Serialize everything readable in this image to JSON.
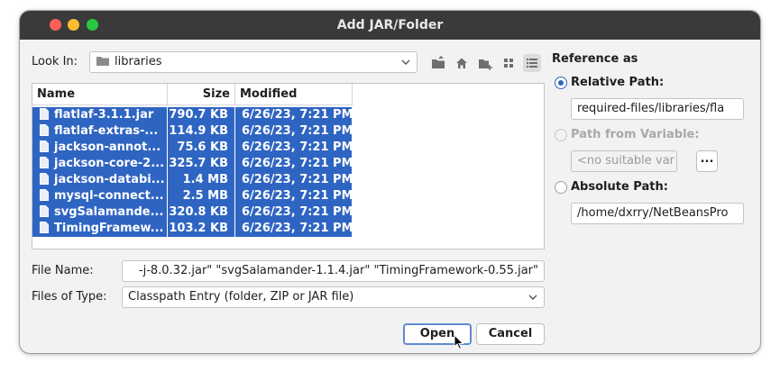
{
  "window": {
    "title": "Add JAR/Folder"
  },
  "look_in": {
    "label": "Look In:",
    "value": "libraries"
  },
  "toolbar": [
    "up-folder-icon",
    "home-icon",
    "new-folder-icon",
    "list-view-icon",
    "details-view-icon"
  ],
  "file_table": {
    "headers": {
      "name": "Name",
      "size": "Size",
      "modified": "Modified"
    },
    "rows": [
      {
        "name": "flatlaf-3.1.1.jar",
        "size": "790.7 KB",
        "modified": "6/26/23, 7:21 PM"
      },
      {
        "name": "flatlaf-extras-...",
        "size": "114.9 KB",
        "modified": "6/26/23, 7:21 PM"
      },
      {
        "name": "jackson-annot...",
        "size": "75.6 KB",
        "modified": "6/26/23, 7:21 PM"
      },
      {
        "name": "jackson-core-2...",
        "size": "325.7 KB",
        "modified": "6/26/23, 7:21 PM"
      },
      {
        "name": "jackson-databi...",
        "size": "1.4 MB",
        "modified": "6/26/23, 7:21 PM"
      },
      {
        "name": "mysql-connect...",
        "size": "2.5 MB",
        "modified": "6/26/23, 7:21 PM"
      },
      {
        "name": "svgSalamande...",
        "size": "320.8 KB",
        "modified": "6/26/23, 7:21 PM"
      },
      {
        "name": "TimingFramew...",
        "size": "103.2 KB",
        "modified": "6/26/23, 7:21 PM"
      }
    ]
  },
  "file_name": {
    "label": "File Name:",
    "value": "-j-8.0.32.jar\" \"svgSalamander-1.1.4.jar\" \"TimingFramework-0.55.jar\""
  },
  "files_of_type": {
    "label": "Files of Type:",
    "value": "Classpath Entry (folder, ZIP or JAR file)"
  },
  "buttons": {
    "open": "Open",
    "cancel": "Cancel"
  },
  "reference": {
    "title": "Reference as",
    "relative_label": "Relative Path:",
    "relative_value": "required-files/libraries/fla",
    "variable_label": "Path from Variable:",
    "variable_value": "<no suitable var",
    "browse": "...",
    "absolute_label": "Absolute Path:",
    "absolute_value": "/home/dxrry/NetBeansPro"
  },
  "colors": {
    "selection": "#2f65c2",
    "titlebar": "#3a3a3a",
    "accent": "#2f65c2"
  }
}
